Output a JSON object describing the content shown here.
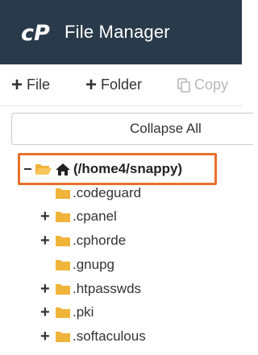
{
  "app": {
    "title": "File Manager",
    "logo_icon": "cpanel-logo"
  },
  "toolbar": {
    "file_label": "File",
    "folder_label": "Folder",
    "copy_label": "Copy"
  },
  "collapse_label": "Collapse All",
  "tree": {
    "root": {
      "label": "(/home4/snappy)",
      "expanded": true,
      "selected": true
    },
    "items": [
      {
        "label": ".codeguard",
        "expandable": false
      },
      {
        "label": ".cpanel",
        "expandable": true
      },
      {
        "label": ".cphorde",
        "expandable": true
      },
      {
        "label": ".gnupg",
        "expandable": false
      },
      {
        "label": ".htpasswds",
        "expandable": true
      },
      {
        "label": ".pki",
        "expandable": true
      },
      {
        "label": ".softaculous",
        "expandable": true
      }
    ]
  },
  "colors": {
    "header_bg": "#293a4a",
    "folder": "#f0b43a",
    "highlight": "#e8702a"
  }
}
